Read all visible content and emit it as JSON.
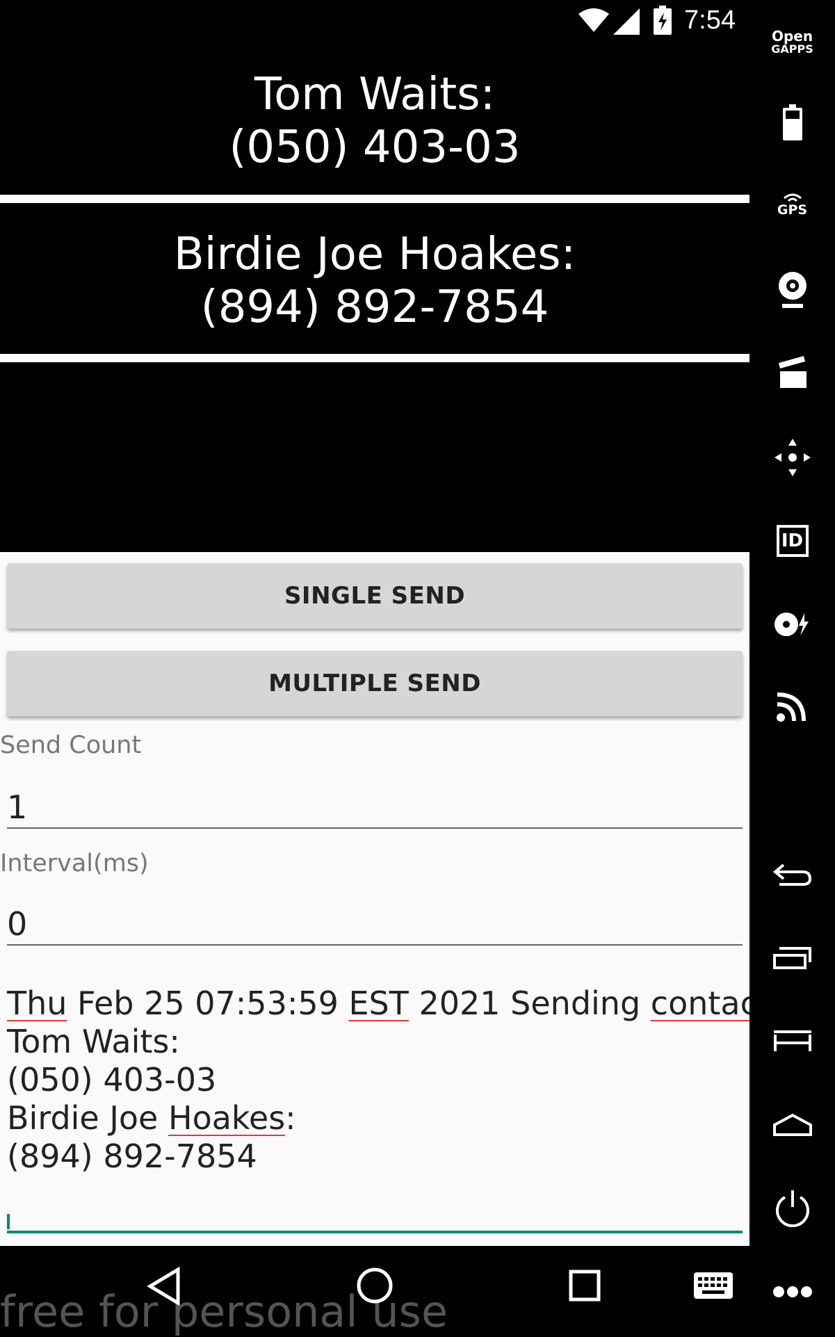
{
  "status_bar": {
    "time": "7:54"
  },
  "contacts": [
    {
      "name": "Tom Waits:",
      "phone": "(050) 403-03"
    },
    {
      "name": "Birdie Joe Hoakes:",
      "phone": "(894) 892-7854"
    }
  ],
  "buttons": {
    "single_send": "SINGLE SEND",
    "multiple_send": "MULTIPLE SEND"
  },
  "send_count": {
    "label": "Send Count",
    "value": "1"
  },
  "interval": {
    "label": "Interval(ms)",
    "value": "0"
  },
  "log": {
    "date_word": "Thu",
    "date_rest": " Feb 25 07:53:59 ",
    "tz": "EST",
    "date_tail": " 2021 Sending ",
    "contacts_word": "contacts",
    "line2": "Tom Waits:",
    "line3": "(050) 403-03",
    "line4_pre": "Birdie Joe ",
    "line4_word": "Hoakes",
    "line4_post": ":",
    "line5": "(894) 892-7854"
  },
  "watermark": "free for personal use",
  "toolbar": {
    "opengapps_line1": "Open",
    "opengapps_line2": "GAPPS",
    "gps_label": "GPS",
    "id_label": "ID"
  },
  "icons": [
    "wifi-icon",
    "signal-icon",
    "battery-icon",
    "opengapps-icon",
    "battery-widget-icon",
    "gps-icon",
    "camera-icon",
    "clapper-icon",
    "move-icon",
    "id-icon",
    "media-icon",
    "cast-icon",
    "back-icon",
    "recents-icon",
    "menu-icon",
    "home-icon",
    "power-icon",
    "more-icon",
    "keyboard-icon"
  ]
}
